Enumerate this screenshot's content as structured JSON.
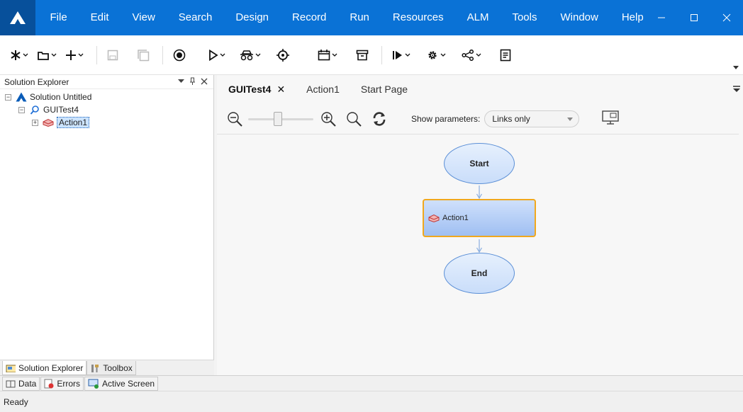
{
  "menu": {
    "items": [
      "File",
      "Edit",
      "View",
      "Search",
      "Design",
      "Record",
      "Run",
      "Resources",
      "ALM",
      "Tools",
      "Window",
      "Help"
    ]
  },
  "window_controls": [
    "minimize-icon",
    "maximize-icon",
    "close-icon"
  ],
  "toolbar": {
    "buttons": [
      "new-icon",
      "open-icon",
      "add-icon",
      "save-icon",
      "save-all-icon",
      "record-icon",
      "run-icon",
      "object-spy-icon",
      "target-icon",
      "calendar-icon",
      "archive-icon",
      "step-icon",
      "settings-icon",
      "share-icon",
      "document-icon"
    ]
  },
  "solution_explorer": {
    "title": "Solution Explorer",
    "tree": {
      "solution": "Solution Untitled",
      "test": "GUITest4",
      "action": "Action1"
    },
    "tabs": {
      "solution_explorer": "Solution Explorer",
      "toolbox": "Toolbox"
    }
  },
  "document": {
    "tabs": {
      "guitest4": "GUITest4",
      "action1": "Action1",
      "start_page": "Start Page"
    },
    "show_parameters_label": "Show parameters:",
    "show_parameters_value": "Links only",
    "zoom_level": 0.45
  },
  "flow": {
    "start": "Start",
    "action": "Action1",
    "end": "End"
  },
  "bottom_tabs": {
    "data": "Data",
    "errors": "Errors",
    "active_screen": "Active Screen"
  },
  "status": "Ready",
  "colors": {
    "titlebar": "#0a72d6",
    "logo_bg": "#07509b",
    "action_border": "#f0a81e",
    "node_border": "#5b8fd6"
  }
}
